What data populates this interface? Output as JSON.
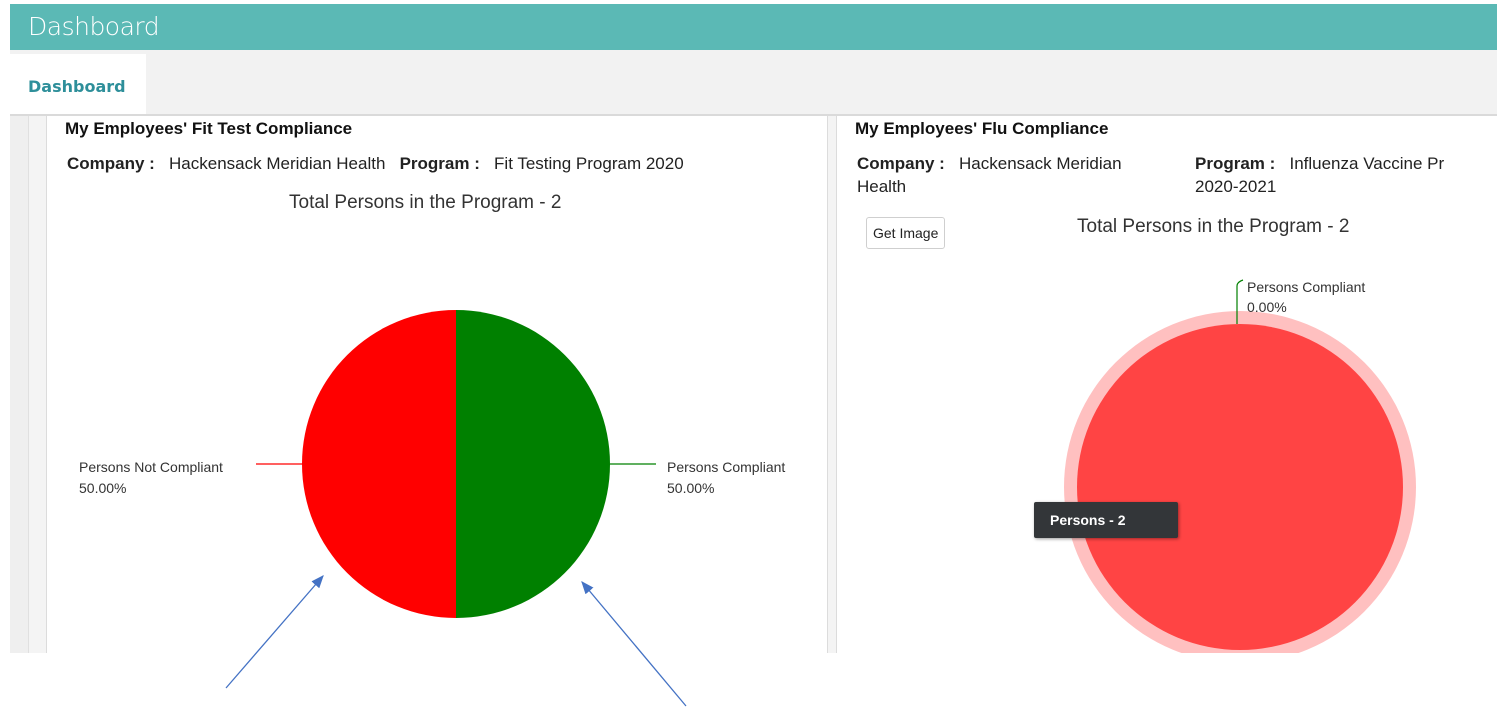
{
  "header": {
    "title": "Dashboard"
  },
  "tabs": [
    {
      "label": "Dashboard"
    }
  ],
  "colors": {
    "header_bg": "#5bb9b5",
    "compliant": "#008000",
    "not_compliant": "#ff0000",
    "flu_not_compliant": "#ff4444",
    "flu_ring": "#ffc0c0"
  },
  "panels": {
    "fit": {
      "title": "My Employees' Fit Test Compliance",
      "company_label": "Company :",
      "company": "Hackensack Meridian Health",
      "program_label": "Program :",
      "program": "Fit Testing Program 2020",
      "total": "Total Persons in the Program - 2"
    },
    "flu": {
      "title": "My Employees' Flu Compliance",
      "company_label": "Company :",
      "company_line1": "Hackensack Meridian",
      "company_line2": "Health",
      "program_label": "Program :",
      "program_line1": "Influenza Vaccine Pr",
      "program_line2": "2020-2021",
      "get_image": "Get Image",
      "total": "Total Persons in the Program - 2",
      "tooltip": "Persons - 2"
    }
  },
  "chart_data": [
    {
      "type": "pie",
      "title": "My Employees' Fit Test Compliance",
      "categories": [
        "Persons Compliant",
        "Persons Not Compliant"
      ],
      "values": [
        50.0,
        50.0
      ],
      "labels": [
        {
          "name": "Persons Compliant",
          "pct": "50.00%"
        },
        {
          "name": "Persons Not Compliant",
          "pct": "50.00%"
        }
      ],
      "colors": [
        "#008000",
        "#ff0000"
      ]
    },
    {
      "type": "pie",
      "title": "My Employees' Flu Compliance",
      "categories": [
        "Persons Compliant",
        "Persons Not Compliant"
      ],
      "values": [
        0.0,
        100.0
      ],
      "labels": [
        {
          "name": "Persons Compliant",
          "pct": "0.00%"
        }
      ],
      "colors": [
        "#008000",
        "#ff4444"
      ]
    }
  ]
}
